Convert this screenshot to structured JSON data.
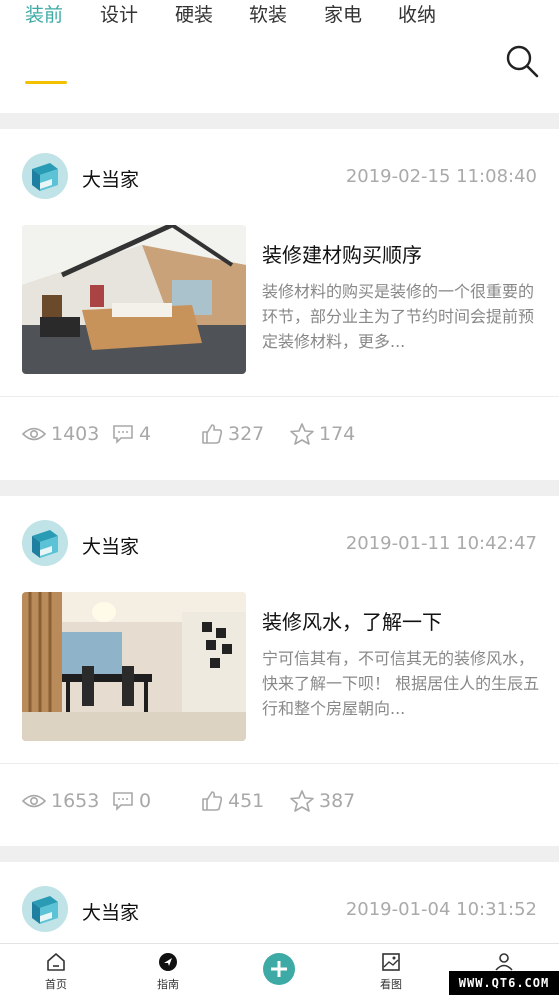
{
  "tabs": [
    "装前",
    "设计",
    "硬装",
    "软装",
    "家电",
    "收纳"
  ],
  "active_tab": "装前",
  "articles": [
    {
      "author": "大当家",
      "time": "2019-02-15 11:08:40",
      "title": "装修建材购买顺序",
      "summary": "装修材料的购买是装修的一个很重要的环节，部分业主为了节约时间会提前预定装修材料，更多...",
      "views": "1403",
      "comments": "4",
      "likes": "327",
      "stars": "174"
    },
    {
      "author": "大当家",
      "time": "2019-01-11 10:42:47",
      "title": "装修风水，了解一下",
      "summary": "宁可信其有，不可信其无的装修风水，快来了解一下呗！ 根据居住人的生辰五行和整个房屋朝向...",
      "views": "1653",
      "comments": "0",
      "likes": "451",
      "stars": "387"
    },
    {
      "author": "大当家",
      "time": "2019-01-04 10:31:52"
    }
  ],
  "bottom_nav": {
    "home": "首页",
    "guide": "指南",
    "gallery": "看图"
  },
  "watermark": "WWW.QT6.COM",
  "colors": {
    "accent": "#3eaaa6",
    "underline": "#f2c200"
  }
}
